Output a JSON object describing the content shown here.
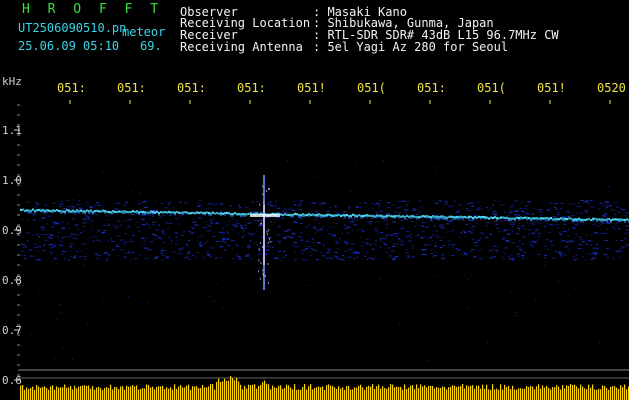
{
  "header": {
    "app_title": "H R O F F T",
    "filename": "UT2506090510.pn",
    "suffix_label": "meteor",
    "datetime": "25.06.09 05:10",
    "count": "69.",
    "fields": [
      {
        "label": "Observer",
        "value": ": Masaki Kano"
      },
      {
        "label": "Receiving Location",
        "value": ": Shibukawa, Gunma, Japan"
      },
      {
        "label": "Receiver",
        "value": ": RTL-SDR SDR# 43dB L15 96.7MHz CW"
      },
      {
        "label": "Receiving Antenna",
        "value": ": 5el Yagi Az 280 for Seoul"
      }
    ]
  },
  "time_axis": {
    "unit_label": "kHz",
    "ticks": [
      "051:",
      "051:",
      "051:",
      "051:",
      "051!",
      "051(",
      "051:",
      "051(",
      "051!",
      "0520"
    ]
  },
  "freq_axis": {
    "ticks": [
      "1.1",
      "1.0",
      "0.9",
      "0.8",
      "0.7",
      "0.6"
    ]
  },
  "colors": {
    "trace": "#4fe0ff",
    "noise": "#1f3cff",
    "meteor": "#ffffff",
    "bottom_bar": "#ffd700"
  }
}
